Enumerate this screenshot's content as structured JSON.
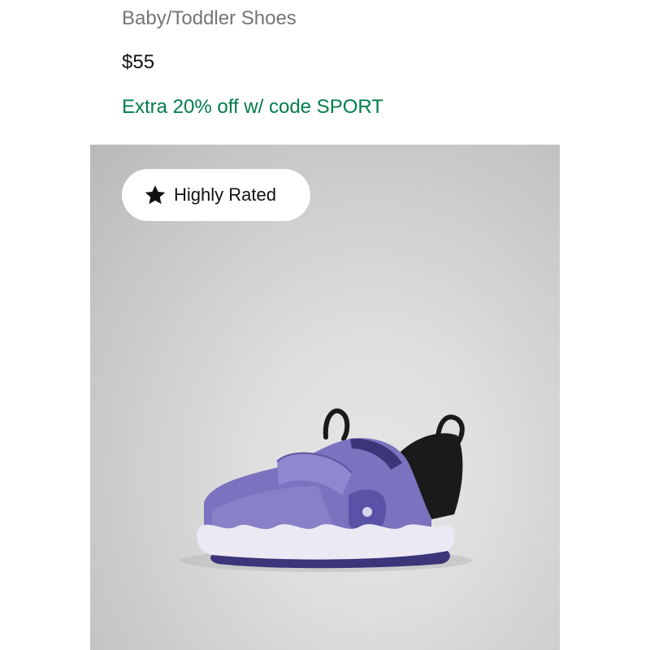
{
  "product": {
    "subtitle": "Baby/Toddler Shoes",
    "price": "$55",
    "promo": "Extra 20% off w/ code SPORT"
  },
  "image": {
    "badge": {
      "icon": "star-icon",
      "label": "Highly Rated"
    },
    "product_image": "purple-toddler-shoe-image"
  },
  "colors": {
    "promo": "#007d48",
    "subtitle": "#757575",
    "price": "#111111",
    "card_background": "#d2d2d2",
    "shoe_upper": "#7b73bf",
    "shoe_sole": "#ece9f5",
    "shoe_dark": "#1a1a1a"
  }
}
